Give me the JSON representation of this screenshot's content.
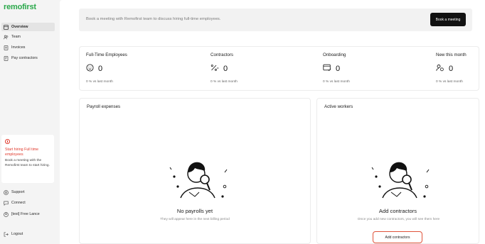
{
  "app": {
    "logo": "remofirst"
  },
  "sidebar": {
    "items": [
      {
        "label": "Overview",
        "icon": "grid-icon",
        "active": true
      },
      {
        "label": "Team",
        "icon": "team-icon",
        "active": false
      },
      {
        "label": "Invoices",
        "icon": "invoice-icon",
        "active": false
      },
      {
        "label": "Pay contractors",
        "icon": "pay-icon",
        "active": false
      }
    ],
    "hire_card": {
      "title": "Start hiring Full time employees",
      "text": "Book a meeting with the Remofirst team to start hiring."
    },
    "bottom_items": [
      {
        "label": "Support",
        "icon": "support-icon"
      },
      {
        "label": "Connect",
        "icon": "chat-icon"
      },
      {
        "label": "[test] Free Lance",
        "icon": "company-icon"
      },
      {
        "label": "Logout",
        "icon": "logout-icon"
      }
    ]
  },
  "banner": {
    "text": "Book a meeting with Remofirst team to discuss hiring full-time employees.",
    "button": "Book a meeting"
  },
  "stats": [
    {
      "title": "Full-Time Employees",
      "value": "0",
      "sub": "0 %  vs last month",
      "icon": "smiley-icon"
    },
    {
      "title": "Contractors",
      "value": "0",
      "sub": "0 %  vs last month",
      "icon": "percent-icon"
    },
    {
      "title": "Onboarding",
      "value": "0",
      "sub": "0 %  vs last month",
      "icon": "onboarding-icon"
    },
    {
      "title": "New this month",
      "value": "0",
      "sub": "0 %  vs last month",
      "icon": "new-user-icon"
    }
  ],
  "payroll": {
    "title": "Payroll expenses",
    "empty_title": "No payrolls yet",
    "empty_sub": "They will appear here in the next billing period"
  },
  "workers": {
    "title": "Active workers",
    "empty_title": "Add contractors",
    "empty_sub": "Once you add new contractors, you will see them here",
    "button": "Add contractors"
  },
  "colors": {
    "brand": "#2aa84a",
    "alert": "#e0382b",
    "highlight": "#e0533a"
  }
}
